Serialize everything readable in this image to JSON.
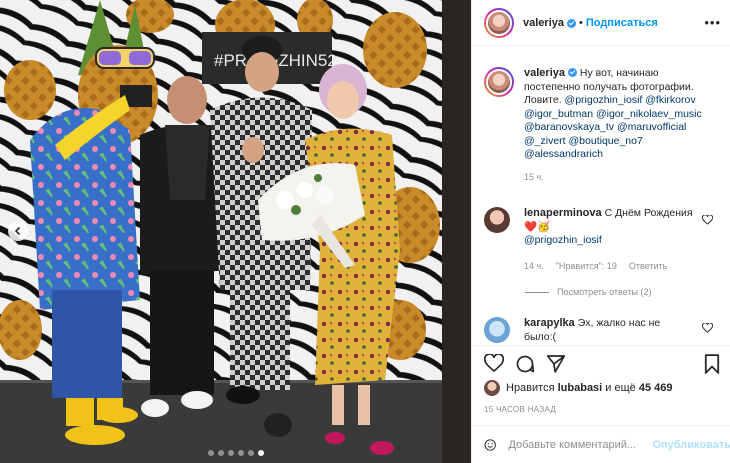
{
  "post": {
    "author": "valeriya",
    "follow_label": "Подписаться",
    "separator": "•",
    "more_label": "•••",
    "caption": {
      "author": "valeriya",
      "text": "Ну вот, начинаю постепенно получать фотографии. Ловите.",
      "mentions": [
        "@prigozhin_iosif",
        "@fkirkorov",
        "@igor_butman",
        "@igor_nikolaev_music",
        "@baranovskaya_tv",
        "@maruvofficial",
        "@_zivert",
        "@boutique_no7",
        "@alessandrarich"
      ],
      "time": "15 ч."
    },
    "comments": [
      {
        "author": "lenaperminova",
        "text": "С Днём Рождения",
        "emoji": "❤️🥳",
        "mention": "@prigozhin_iosif",
        "time": "14 ч.",
        "likes_label": "\"Нравится\": 19",
        "reply_label": "Ответить",
        "view_replies": "Посмотреть ответы (2)"
      },
      {
        "author": "karapylka",
        "text": "Эх, жалко нас не было:("
      }
    ],
    "liked_by_prefix": "Нравится",
    "liked_by_user": "lubabasi",
    "liked_by_suffix": "и ещё",
    "likes_count": "45 469",
    "timestamp": "15 ЧАСОВ НАЗАД",
    "comment_placeholder": "Добавьте комментарий...",
    "publish_label": "Опубликовать",
    "photo_backdrop_text": "#PRIGOZHIN52",
    "carousel": {
      "total": 6,
      "active_index": 5
    }
  },
  "colors": {
    "link": "#0095f6",
    "mention": "#00376b",
    "muted": "#8e8e8e",
    "verified": "#3897f0",
    "heart_red": "#ed4956"
  },
  "icons": [
    "chevron-left-icon",
    "heart-icon",
    "comment-icon",
    "share-icon",
    "bookmark-icon",
    "verified-icon",
    "emoji-icon",
    "more-icon"
  ]
}
